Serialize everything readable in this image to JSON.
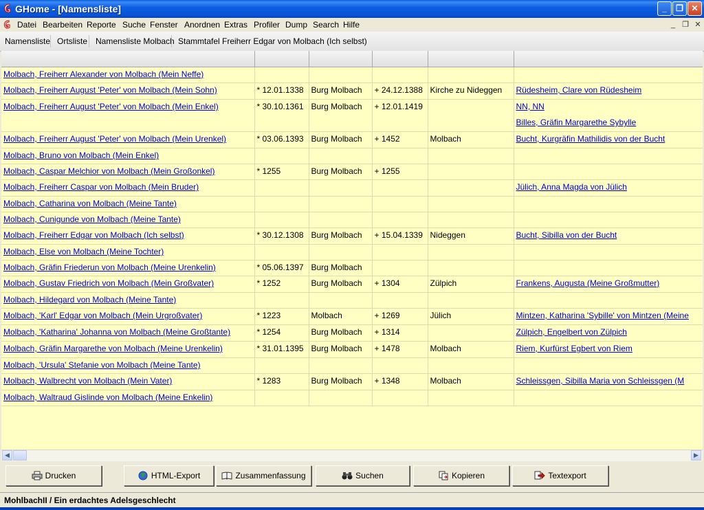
{
  "window": {
    "title": "GHome - [Namensliste]",
    "minimize_glyph": "_",
    "maximize_glyph": "❐",
    "close_glyph": "✕",
    "titlebar_color": "#0A5FDD",
    "icon": "ghome-app-icon"
  },
  "menu": {
    "items": [
      "Datei",
      "Bearbeiten",
      "Reporte",
      "Suche",
      "Fenster",
      "Anordnen",
      "Extras",
      "Profiler",
      "Dump",
      "Search",
      "Hilfe"
    ],
    "mdi_minimize": "_",
    "mdi_restore": "❐",
    "mdi_close": "✕"
  },
  "tabs": [
    "Namensliste",
    "Ortsliste",
    "Namensliste Molbach",
    "Stammtafel Freiherr Edgar von Molbach (Ich selbst)"
  ],
  "table": {
    "background": "#FFFFC4",
    "link_color": "#0000CC",
    "rows": [
      {
        "name": "Molbach, Freiherr Alexander von Molbach (Mein Neffe)",
        "birth": "",
        "birth_place": "",
        "death": "",
        "death_place": "",
        "spouses": []
      },
      {
        "name": "Molbach, Freiherr August 'Peter' von Molbach (Mein Sohn)",
        "birth": "* 12.01.1338",
        "birth_place": "Burg Molbach",
        "death": "+ 24.12.1388",
        "death_place": "Kirche zu Nideggen",
        "spouses": [
          "Rüdesheim, Clare von Rüdesheim"
        ]
      },
      {
        "name": "Molbach, Freiherr August 'Peter' von Molbach (Mein Enkel)",
        "birth": "* 30.10.1361",
        "birth_place": "Burg Molbach",
        "death": "+ 12.01.1419",
        "death_place": "",
        "spouses": [
          "NN, NN",
          "Billes, Gräfin Margarethe Sybylle"
        ]
      },
      {
        "name": "Molbach, Freiherr August 'Peter' von Molbach (Mein Urenkel)",
        "birth": "* 03.06.1393",
        "birth_place": "Burg Molbach",
        "death": "+ 1452",
        "death_place": "Molbach",
        "spouses": [
          "Bucht, Kurgräfin Mathilidis von der Bucht"
        ]
      },
      {
        "name": "Molbach, Bruno von Molbach (Mein Enkel)",
        "birth": "",
        "birth_place": "",
        "death": "",
        "death_place": "",
        "spouses": []
      },
      {
        "name": "Molbach, Caspar Melchior von Molbach (Mein Großonkel)",
        "birth": "* 1255",
        "birth_place": "Burg Molbach",
        "death": "+ 1255",
        "death_place": "",
        "spouses": []
      },
      {
        "name": "Molbach, Freiherr Caspar von Molbach (Mein Bruder)",
        "birth": "",
        "birth_place": "",
        "death": "",
        "death_place": "",
        "spouses": [
          "Jülich, Anna Magda von Jülich"
        ]
      },
      {
        "name": "Molbach, Catharina von Molbach (Meine Tante)",
        "birth": "",
        "birth_place": "",
        "death": "",
        "death_place": "",
        "spouses": []
      },
      {
        "name": "Molbach, Cunigunde von Molbach (Meine Tante)",
        "birth": "",
        "birth_place": "",
        "death": "",
        "death_place": "",
        "spouses": []
      },
      {
        "name": "Molbach, Freiherr Edgar von Molbach (Ich selbst)",
        "birth": "* 30.12.1308",
        "birth_place": "Burg Molbach",
        "death": "+ 15.04.1339",
        "death_place": "Nideggen",
        "spouses": [
          "Bucht, Sibilla von der Bucht"
        ]
      },
      {
        "name": "Molbach, Else von Molbach (Meine Tochter)",
        "birth": "",
        "birth_place": "",
        "death": "",
        "death_place": "",
        "spouses": []
      },
      {
        "name": "Molbach, Gräfin Friederun von Molbach (Meine Urenkelin)",
        "birth": "* 05.06.1397",
        "birth_place": "Burg Molbach",
        "death": "",
        "death_place": "",
        "spouses": []
      },
      {
        "name": "Molbach, Gustav Friedrich von Molbach (Mein Großvater)",
        "birth": "* 1252",
        "birth_place": "Burg Molbach",
        "death": "+ 1304",
        "death_place": "Zülpich",
        "spouses": [
          "Frankens, Augusta (Meine Großmutter)"
        ]
      },
      {
        "name": "Molbach, Hildegard von Molbach (Meine Tante)",
        "birth": "",
        "birth_place": "",
        "death": "",
        "death_place": "",
        "spouses": []
      },
      {
        "name": "Molbach, 'Karl' Edgar von Molbach (Mein Urgroßvater)",
        "birth": "* 1223",
        "birth_place": "Molbach",
        "death": "+ 1269",
        "death_place": "Jülich",
        "spouses": [
          "Mintzen, Katharina 'Sybille' von Mintzen (Meine"
        ]
      },
      {
        "name": "Molbach, 'Katharina' Johanna von Molbach (Meine Großtante)",
        "birth": "* 1254",
        "birth_place": "Burg Molbach",
        "death": "+ 1314",
        "death_place": "",
        "spouses": [
          "Zülpich, Engelbert von Zülpich"
        ]
      },
      {
        "name": "Molbach, Gräfin Margarethe von Molbach (Meine Urenkelin)",
        "birth": "* 31.01.1395",
        "birth_place": "Burg Molbach",
        "death": "+ 1478",
        "death_place": "Molbach",
        "spouses": [
          "Riem, Kurfürst Egbert von Riem"
        ]
      },
      {
        "name": "Molbach, 'Ursula' Stefanie von Molbach (Meine Tante)",
        "birth": "",
        "birth_place": "",
        "death": "",
        "death_place": "",
        "spouses": []
      },
      {
        "name": "Molbach, Walbrecht von Molbach (Mein Vater)",
        "birth": "* 1283",
        "birth_place": "Burg Molbach",
        "death": "+ 1348",
        "death_place": "Molbach",
        "spouses": [
          "Schleissgen, Sibilla Maria von Schleissgen (M"
        ]
      },
      {
        "name": "Molbach, Waltraud Gislinde von Molbach (Meine Enkelin)",
        "birth": "",
        "birth_place": "",
        "death": "",
        "death_place": "",
        "spouses": []
      }
    ]
  },
  "scrollbar": {
    "left_arrow": "◀",
    "right_arrow": "▶"
  },
  "toolbar": {
    "buttons": [
      {
        "label": "Drucken",
        "icon": "printer-icon"
      },
      {
        "label": "HTML-Export",
        "icon": "globe-icon"
      },
      {
        "label": "Zusammenfassung",
        "icon": "book-icon"
      },
      {
        "label": "Suchen",
        "icon": "binoculars-icon"
      },
      {
        "label": "Kopieren",
        "icon": "copy-icon"
      },
      {
        "label": "Textexport",
        "icon": "text-export-icon"
      }
    ]
  },
  "status": {
    "text": "MohlbachII / Ein erdachtes Adelsgeschlecht"
  }
}
